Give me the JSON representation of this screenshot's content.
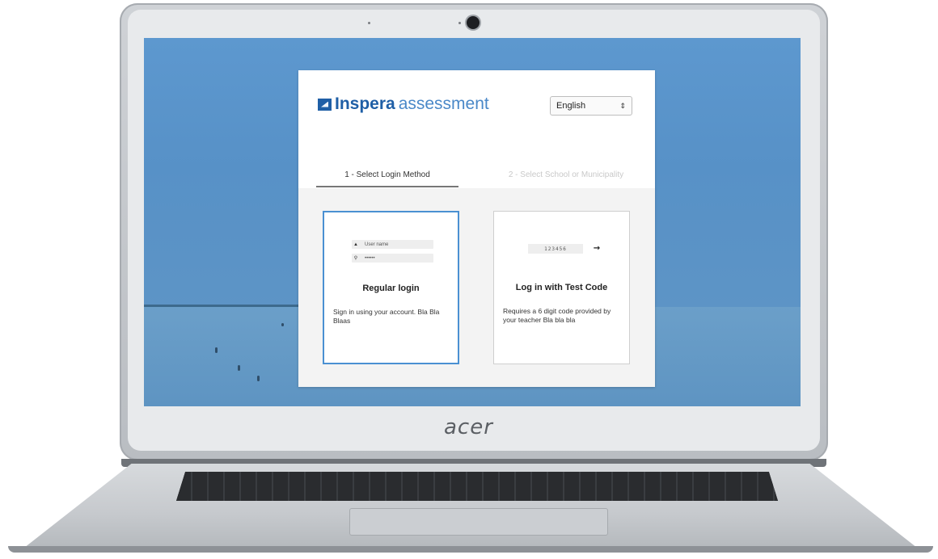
{
  "device": {
    "brand": "acer"
  },
  "app": {
    "logo_strong": "Inspera",
    "logo_light": "assessment",
    "language": {
      "selected": "English",
      "arrow_glyph": "⇕"
    },
    "steps": [
      {
        "label": "1 - Select Login Method",
        "active": true
      },
      {
        "label": "2 - Select School or Municipality",
        "active": false
      }
    ],
    "options": [
      {
        "title": "Regular login",
        "description": "Sign in using your account. Bla Bla Blaas",
        "username_placeholder": "User name",
        "password_placeholder": "••••••",
        "user_icon": "user-icon",
        "key_icon": "key-icon"
      },
      {
        "title": "Log in with Test Code",
        "description": "Requires a 6 digit code provided by your teacher Bla bla bla",
        "code_placeholder": "123456",
        "submit_icon": "arrow-right-icon"
      }
    ]
  },
  "colors": {
    "brand_blue": "#1f5fa6",
    "brand_light_blue": "#4a88c8",
    "selected_border": "#4a90d2",
    "screen_background": "#5d98cf"
  }
}
